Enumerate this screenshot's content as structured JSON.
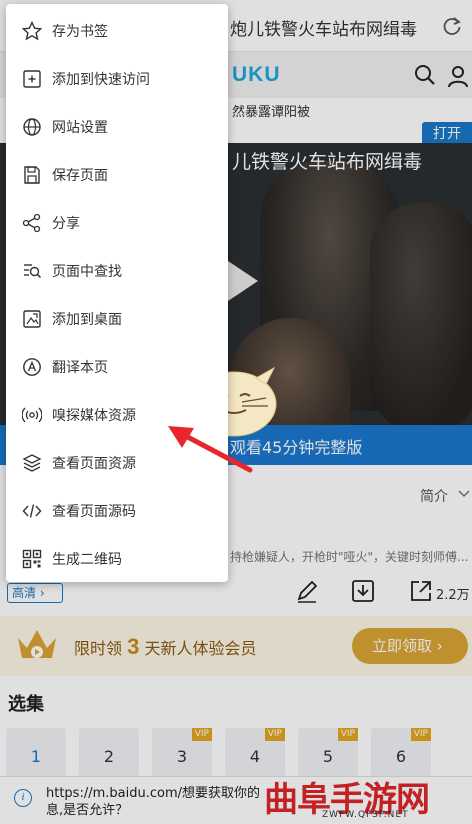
{
  "topbar": {
    "title": "炮儿铁警火车站布网缉毒"
  },
  "site": {
    "logo": "UKU",
    "ticker": "然暴露谭阳被",
    "open_label": "打开"
  },
  "video": {
    "title": "儿铁警火车站布网缉毒",
    "watch_label": "观看45分钟完整版"
  },
  "info": {
    "intro_label": "简介",
    "description": "持枪嫌疑人，开枪时\"哑火\"，关键时刻师傅..."
  },
  "actions": {
    "quality_label": "高清",
    "share_count": "2.2万"
  },
  "promo": {
    "prefix": "限时领",
    "days": "3",
    "suffix": "天新人体验会员",
    "claim_label": "立即领取"
  },
  "episodes": {
    "title": "选集",
    "items": [
      {
        "number": "1",
        "vip": ""
      },
      {
        "number": "2",
        "vip": ""
      },
      {
        "number": "3",
        "vip": "VIP"
      },
      {
        "number": "4",
        "vip": "VIP"
      },
      {
        "number": "5",
        "vip": "VIP"
      },
      {
        "number": "6",
        "vip": "VIP"
      }
    ]
  },
  "permission_prompt": {
    "text": "https://m.baidu.com/想要获取你的息,是否允许？"
  },
  "watermark": {
    "text": "曲阜手游网",
    "url": "ZWFW.QFSP.NET"
  },
  "menu": {
    "items": [
      {
        "label": "存为书签",
        "icon": "star-icon"
      },
      {
        "label": "添加到快速访问",
        "icon": "quick-access-icon"
      },
      {
        "label": "网站设置",
        "icon": "globe-icon"
      },
      {
        "label": "保存页面",
        "icon": "save-page-icon"
      },
      {
        "label": "分享",
        "icon": "share-icon"
      },
      {
        "label": "页面中查找",
        "icon": "find-in-page-icon"
      },
      {
        "label": "添加到桌面",
        "icon": "add-to-desktop-icon"
      },
      {
        "label": "翻译本页",
        "icon": "translate-icon"
      },
      {
        "label": "嗅探媒体资源",
        "icon": "media-sniff-icon"
      },
      {
        "label": "查看页面资源",
        "icon": "layers-icon"
      },
      {
        "label": "查看页面源码",
        "icon": "code-icon"
      },
      {
        "label": "生成二维码",
        "icon": "qr-code-icon"
      }
    ]
  },
  "colors": {
    "accent": "#1a78c8",
    "logo": "#1fa7e0",
    "promo_gold": "#d9a435",
    "arrow": "#e8262b",
    "watermark": "#e0262b"
  }
}
